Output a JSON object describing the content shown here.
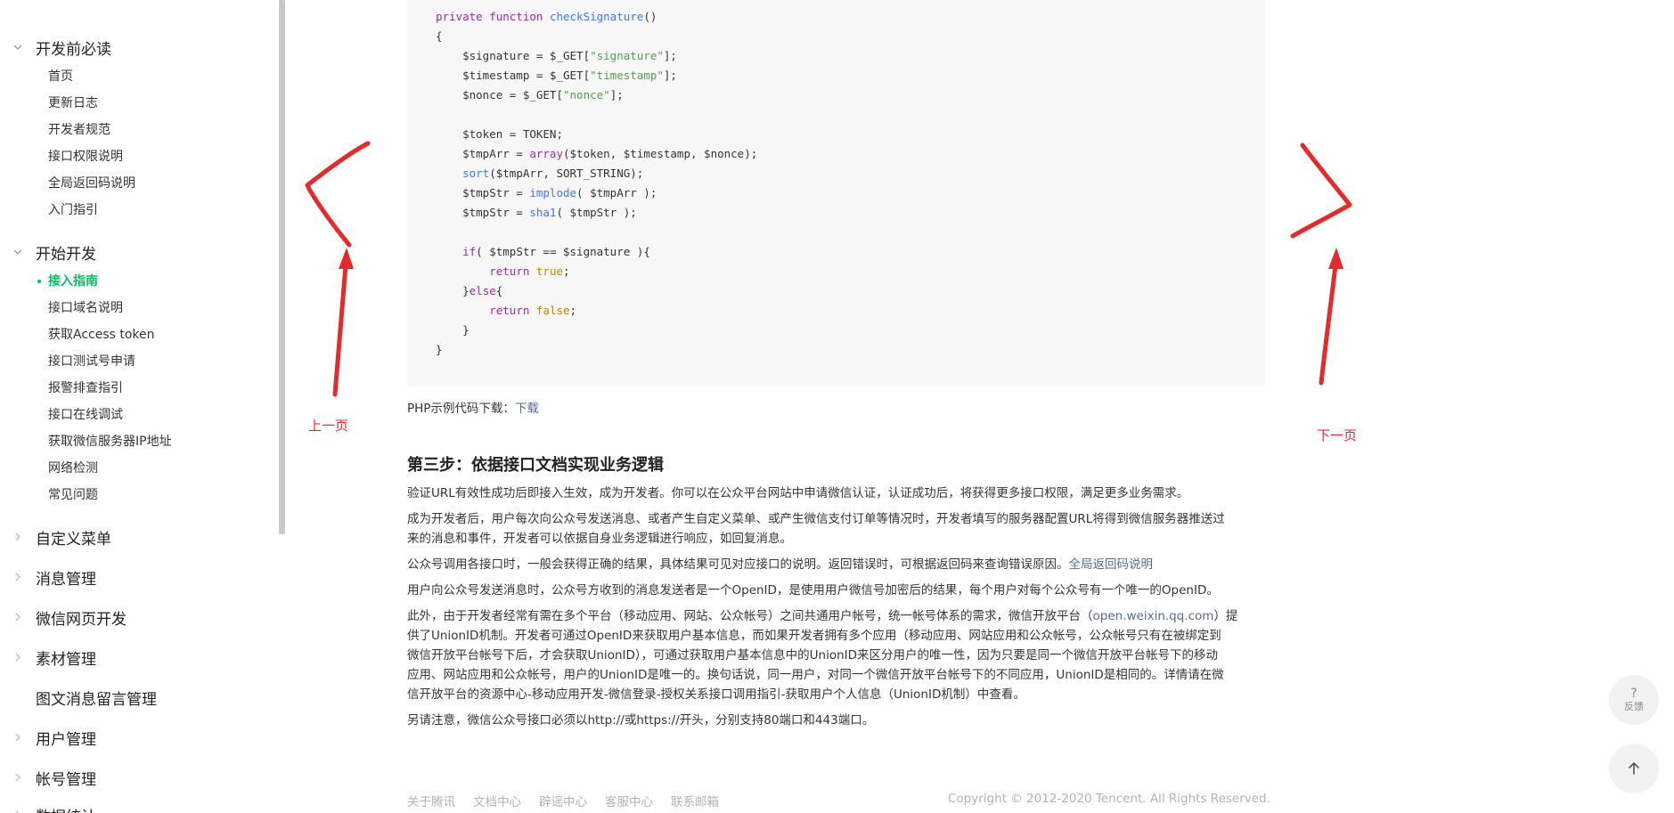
{
  "sidebar": {
    "sections": [
      {
        "label": "开发前必读",
        "expanded": true,
        "items": [
          "首页",
          "更新日志",
          "开发者规范",
          "接口权限说明",
          "全局返回码说明",
          "入门指引"
        ]
      },
      {
        "label": "开始开发",
        "expanded": true,
        "items": [
          "接入指南",
          "接口域名说明",
          "获取Access token",
          "接口测试号申请",
          "报警排查指引",
          "接口在线调试",
          "获取微信服务器IP地址",
          "网络检测",
          "常见问题"
        ],
        "active_item": "接入指南"
      },
      {
        "label": "自定义菜单",
        "expanded": false
      },
      {
        "label": "消息管理",
        "expanded": false
      },
      {
        "label": "微信网页开发",
        "expanded": false
      },
      {
        "label": "素材管理",
        "expanded": false
      },
      {
        "label": "图文消息留言管理",
        "expanded": false
      },
      {
        "label": "用户管理",
        "expanded": false
      },
      {
        "label": "帐号管理",
        "expanded": false
      },
      {
        "label": "数据统计",
        "expanded": false
      }
    ]
  },
  "code_lines": [
    [
      [
        "private ",
        "kw"
      ],
      [
        "function ",
        "kw"
      ],
      [
        "checkSignature",
        "fn"
      ],
      [
        "()",
        ""
      ]
    ],
    [
      [
        "{",
        ""
      ]
    ],
    [
      [
        "    $signature = $_GET[",
        ""
      ],
      [
        "\"signature\"",
        "str"
      ],
      [
        "];",
        ""
      ]
    ],
    [
      [
        "    $timestamp = $_GET[",
        ""
      ],
      [
        "\"timestamp\"",
        "str"
      ],
      [
        "];",
        ""
      ]
    ],
    [
      [
        "    $nonce = $_GET[",
        ""
      ],
      [
        "\"nonce\"",
        "str"
      ],
      [
        "];",
        ""
      ]
    ],
    [
      [
        "",
        ""
      ]
    ],
    [
      [
        "    $token = TOKEN;",
        ""
      ]
    ],
    [
      [
        "    $tmpArr = ",
        ""
      ],
      [
        "array",
        "kw"
      ],
      [
        "($token, $timestamp, $nonce);",
        ""
      ]
    ],
    [
      [
        "    ",
        ""
      ],
      [
        "sort",
        "fn"
      ],
      [
        "($tmpArr, SORT_STRING);",
        ""
      ]
    ],
    [
      [
        "    $tmpStr = ",
        ""
      ],
      [
        "implode",
        "fn"
      ],
      [
        "( $tmpArr );",
        ""
      ]
    ],
    [
      [
        "    $tmpStr = ",
        ""
      ],
      [
        "sha1",
        "fn"
      ],
      [
        "( $tmpStr );",
        ""
      ]
    ],
    [
      [
        "",
        ""
      ]
    ],
    [
      [
        "    ",
        ""
      ],
      [
        "if",
        "kw"
      ],
      [
        "( $tmpStr == $signature ){",
        ""
      ]
    ],
    [
      [
        "        ",
        ""
      ],
      [
        "return ",
        "kw"
      ],
      [
        "true",
        "lit"
      ],
      [
        ";",
        ""
      ]
    ],
    [
      [
        "    }",
        ""
      ],
      [
        "else",
        "kw"
      ],
      [
        "{",
        ""
      ]
    ],
    [
      [
        "        ",
        ""
      ],
      [
        "return ",
        "kw"
      ],
      [
        "false",
        "lit"
      ],
      [
        ";",
        ""
      ]
    ],
    [
      [
        "    }",
        ""
      ]
    ],
    [
      [
        "}",
        ""
      ]
    ]
  ],
  "main": {
    "php_download_label": "PHP示例代码下载：",
    "php_download_link": "下载",
    "step3_heading": "第三步：依据接口文档实现业务逻辑",
    "para1": "验证URL有效性成功后即接入生效，成为开发者。你可以在公众平台网站中申请微信认证，认证成功后，将获得更多接口权限，满足更多业务需求。",
    "para2_line1": "成为开发者后，用户每次向公众号发送消息、或者产生自定义菜单、或产生微信支付订单等情况时，开发者填写的服务器配置URL将得到微信服务器推送过",
    "para2_line2": "来的消息和事件，开发者可以依据自身业务逻辑进行响应，如回复消息。",
    "para3_text": "公众号调用各接口时，一般会获得正确的结果，具体结果可见对应接口的说明。返回错误时，可根据返回码来查询错误原因。",
    "para3_link": "全局返回码说明",
    "para4": "用户向公众号发送消息时，公众号方收到的消息发送者是一个OpenID，是使用用户微信号加密后的结果，每个用户对每个公众号有一个唯一的OpenID。",
    "para5_line1_pre": "此外，由于开发者经常有需在多个平台（移动应用、网站、公众帐号）之间共通用户帐号，统一帐号体系的需求，微信开放平台（",
    "para5_line1_link": "open.weixin.qq.com",
    "para5_line1_post": "）提",
    "para5_line2": "供了UnionID机制。开发者可通过OpenID来获取用户基本信息，而如果开发者拥有多个应用（移动应用、网站应用和公众帐号，公众帐号只有在被绑定到",
    "para5_line3": "微信开放平台帐号下后，才会获取UnionID），可通过获取用户基本信息中的UnionID来区分用户的唯一性，因为只要是同一个微信开放平台帐号下的移动",
    "para5_line4": "应用、网站应用和公众帐号，用户的UnionID是唯一的。换句话说，同一用户，对同一个微信开放平台帐号下的不同应用，UnionID是相同的。详情请在微",
    "para5_line5": "信开放平台的资源中心-移动应用开发-微信登录-授权关系接口调用指引-获取用户个人信息（UnionID机制）中查看。",
    "para6": "另请注意，微信公众号接口必须以http://或https://开头，分别支持80端口和443端口。"
  },
  "annotations": {
    "prev_label": "上一页",
    "next_label": "下一页",
    "color": "#e8292a"
  },
  "footer": {
    "links": [
      "关于腾讯",
      "文档中心",
      "辟谣中心",
      "客服中心",
      "联系邮箱"
    ],
    "copyright": "Copyright © 2012-2020 Tencent. All Rights Reserved."
  },
  "floating": {
    "feedback_icon": "?",
    "feedback_label": "反馈",
    "top_icon": "arrow-up-icon"
  },
  "colors": {
    "active": "#07c160",
    "link": "#576b95",
    "annotation": "#e8292a"
  }
}
